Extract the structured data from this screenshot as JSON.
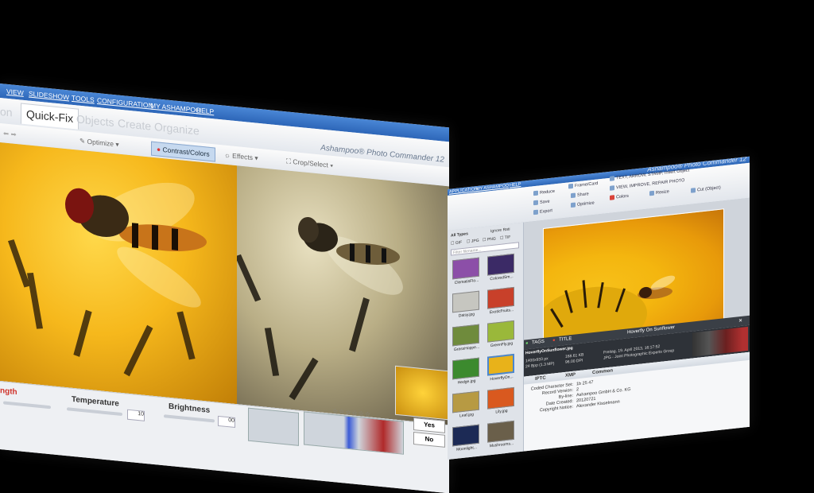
{
  "left_window": {
    "menu": [
      "VIEW",
      "SLIDESHOW",
      "TOOLS",
      "CONFIGURATION",
      "MY ASHAMPOO",
      "HELP"
    ],
    "tabs": [
      {
        "label": "on",
        "active": false
      },
      {
        "label": "Quick-Fix",
        "active": true
      },
      {
        "label": "Objects",
        "active": false
      },
      {
        "label": "Create",
        "active": false
      },
      {
        "label": "Organize",
        "active": false
      }
    ],
    "app_title": "Ashampoo® Photo Commander 12",
    "toolbar": {
      "optimize": "Optimize",
      "contrast_colors": "Contrast/Colors",
      "effects": "Effects",
      "crop_select": "Crop/Select"
    },
    "bottom": {
      "length_label": "ngth",
      "temperature_label": "Temperature",
      "brightness_label": "Brightness",
      "temperature_value": "10",
      "brightness_value": "00",
      "yes": "Yes",
      "no": "No"
    },
    "rating_stars": "☆☆☆☆☆☆"
  },
  "right_window": {
    "menu": [
      "APPLICATION",
      "MY ASHAMPOO",
      "HELP"
    ],
    "app_title": "Ashampoo® Photo Commander 12",
    "ribbon": {
      "reduce": "Reduce",
      "save": "Save",
      "export": "Export",
      "frame_card": "Frame/Card",
      "share": "Share",
      "optimize": "Optimize",
      "text_arrow": "TEXT, ARROW, STAMP, Insert Object",
      "view_improve": "VIEW, IMPROVE, REPAIR PHOTO",
      "colors": "Colors",
      "resize": "Resize",
      "cut_object": "Cut (Object)"
    },
    "sidebar": {
      "type_select": "All Types",
      "ignore": "Ignore Rati",
      "filters": [
        "GIF",
        "JPG",
        "PNG",
        "TIF"
      ],
      "search_placeholder": "Filter filename..."
    },
    "thumbnails": [
      {
        "caption": "ClematisFlo...",
        "color": "#8c4fa8"
      },
      {
        "caption": "ColoredSm...",
        "color": "#3b2a66"
      },
      {
        "caption": "Daisy.jpg",
        "color": "#c6c6c0"
      },
      {
        "caption": "ExoticFruits...",
        "color": "#c8402a"
      },
      {
        "caption": "GrassHoppe...",
        "color": "#6f8b3c"
      },
      {
        "caption": "GreenFly.jpg",
        "color": "#9ab83a"
      },
      {
        "caption": "Hedge.jpg",
        "color": "#3c8a2e"
      },
      {
        "caption": "HoverflyOn...",
        "color": "#e8b21a"
      },
      {
        "caption": "Leaf.jpg",
        "color": "#b79a43"
      },
      {
        "caption": "Lily.jpg",
        "color": "#d9591f"
      },
      {
        "caption": "Moonlight...",
        "color": "#1c2a55"
      },
      {
        "caption": "Mushrooms...",
        "color": "#6a5f4a"
      }
    ],
    "selected_thumbnail": 7,
    "infobar": {
      "tags": "TAGS",
      "title": "TITLE",
      "image_title": "Hoverfly On Sunflower"
    },
    "fileinfo": {
      "filename": "HoverflyOnSunflower.jpg",
      "dimensions": "1400x933 px",
      "bpp": "24 Bpp (1.3 MP)",
      "size": "168.61 KB",
      "dpi": "96.00 DPI",
      "date": "Freitag, 19. April 2013, 16:17:52",
      "format": "JPG - Joint Photographic Experts Group"
    },
    "meta_tabs": [
      "IPTC",
      "XMP",
      "Common"
    ],
    "meta_rows": [
      {
        "key": "Coded Character Set:",
        "value": "1b 25 47"
      },
      {
        "key": "Record Version:",
        "value": "2"
      },
      {
        "key": "By-line:",
        "value": "Ashampoo GmbH & Co. KG"
      },
      {
        "key": "Date Created:",
        "value": "20120721"
      },
      {
        "key": "Copyright Notice:",
        "value": "Alexander Kisselmann"
      }
    ]
  }
}
